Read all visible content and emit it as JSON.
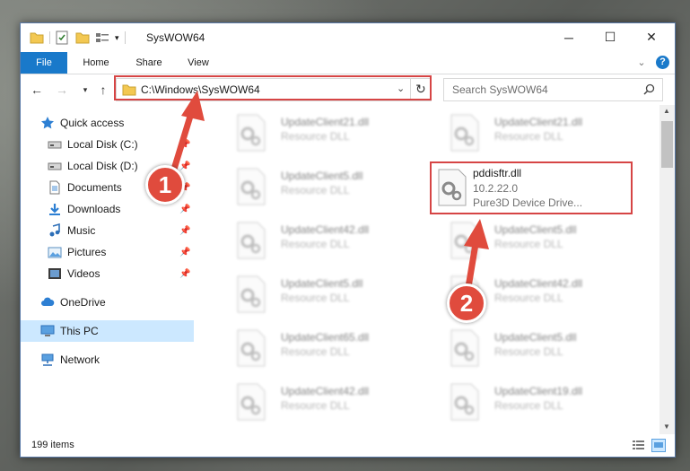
{
  "window": {
    "title": "SysWOW64",
    "controls": {
      "minimize": "─",
      "maximize": "☐",
      "close": "✕"
    }
  },
  "ribbon": {
    "tabs": [
      "File",
      "Home",
      "Share",
      "View"
    ],
    "expand_glyph": "⌄",
    "help_glyph": "?"
  },
  "address": {
    "path": "C:\\Windows\\SysWOW64",
    "search_placeholder": "Search SysWOW64"
  },
  "nav": {
    "items": [
      {
        "label": "Quick access",
        "icon": "star-icon",
        "pinned": false
      },
      {
        "label": "Local Disk (C:)",
        "icon": "drive-icon",
        "pinned": true
      },
      {
        "label": "Local Disk (D:)",
        "icon": "drive-icon",
        "pinned": true
      },
      {
        "label": "Documents",
        "icon": "documents-icon",
        "pinned": true
      },
      {
        "label": "Downloads",
        "icon": "download-icon",
        "pinned": true
      },
      {
        "label": "Music",
        "icon": "music-icon",
        "pinned": true
      },
      {
        "label": "Pictures",
        "icon": "pictures-icon",
        "pinned": true
      },
      {
        "label": "Videos",
        "icon": "videos-icon",
        "pinned": true
      },
      {
        "label": "OneDrive",
        "icon": "cloud-icon",
        "pinned": false
      },
      {
        "label": "This PC",
        "icon": "computer-icon",
        "pinned": false
      },
      {
        "label": "Network",
        "icon": "network-icon",
        "pinned": false
      }
    ]
  },
  "files": {
    "left_column": [
      {
        "name": "UpdateClient21.dll",
        "desc": "Resource DLL"
      },
      {
        "name": "UpdateClient5.dll",
        "desc": "Resource DLL"
      },
      {
        "name": "UpdateClient42.dll",
        "desc": "Resource DLL"
      },
      {
        "name": "UpdateClient5.dll",
        "desc": "Resource DLL"
      },
      {
        "name": "UpdateClient65.dll",
        "desc": "Resource DLL"
      },
      {
        "name": "UpdateClient42.dll",
        "desc": "Resource DLL"
      }
    ],
    "right_column": [
      {
        "name": "UpdateClient21.dll",
        "desc": "Resource DLL"
      },
      {
        "name": "UpdateClient5.dll",
        "desc": "Resource DLL"
      },
      {
        "name": "UpdateClient42.dll",
        "desc": "Resource DLL"
      },
      {
        "name": "UpdateClient5.dll",
        "desc": "Resource DLL"
      },
      {
        "name": "UpdateClient19.dll",
        "desc": "Resource DLL"
      }
    ],
    "highlighted": {
      "name": "pddisftr.dll",
      "version": "10.2.22.0",
      "desc": "Pure3D Device Drive..."
    }
  },
  "status": {
    "item_count": "199 items"
  },
  "callouts": {
    "one": "1",
    "two": "2"
  },
  "colors": {
    "accent": "#1979ca",
    "highlight_red": "#d64545",
    "badge": "#e04b3d"
  }
}
